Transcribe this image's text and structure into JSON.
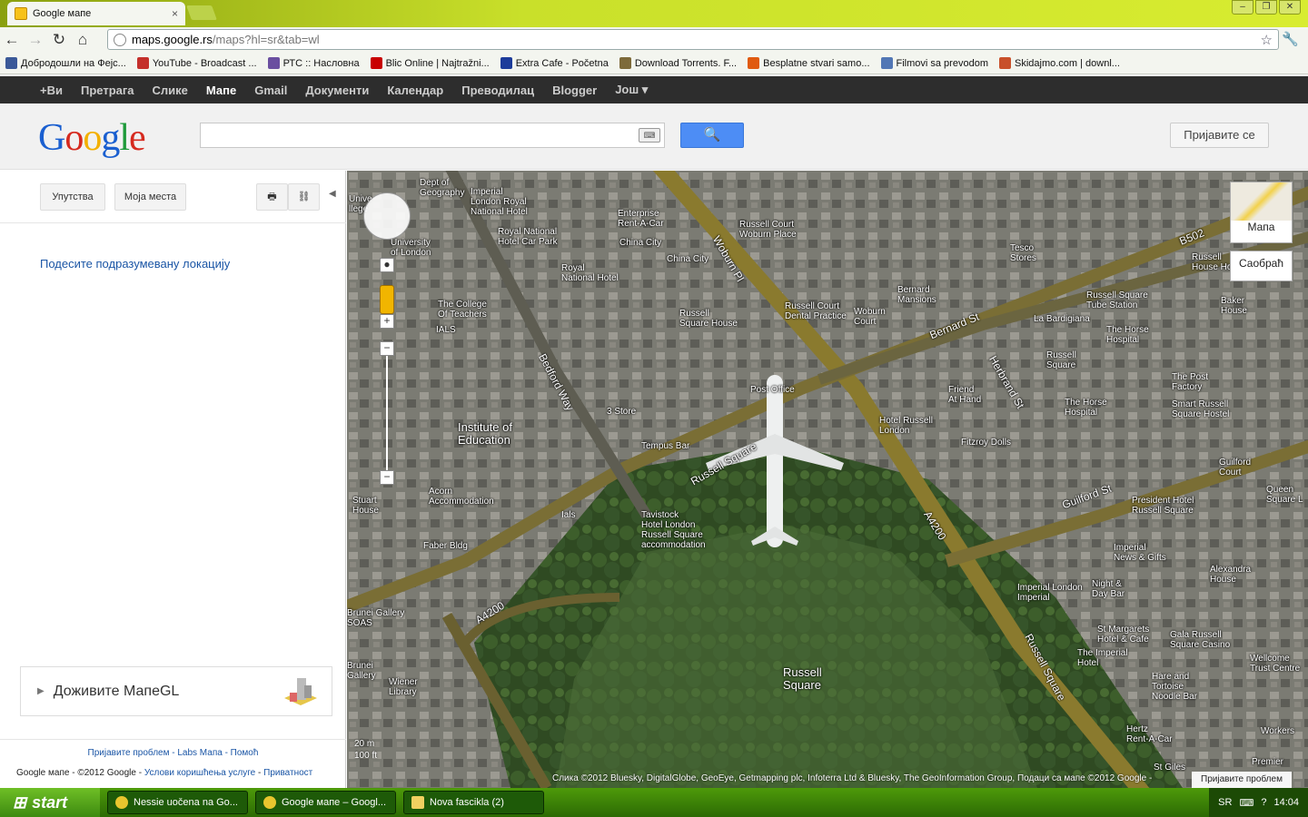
{
  "browser": {
    "tab_title": "Google мапе",
    "url_host": "maps.google.rs",
    "url_path": "/maps?hl=sr&tab=wl",
    "bookmarks": [
      "Добродошли на Фејс...",
      "YouTube - Broadcast ...",
      "РТС :: Насловна",
      "Blic Online | Najtražni...",
      "Extra Cafe - Početna",
      "Download Torrents. F...",
      "Besplatne stvari samo...",
      "Filmovi sa prevodom",
      "Skidajmo.com | downl..."
    ]
  },
  "gbar": {
    "items": [
      "+Ви",
      "Претрага",
      "Слике",
      "Мапе",
      "Gmail",
      "Документи",
      "Календар",
      "Преводилац",
      "Blogger",
      "Још ▾"
    ]
  },
  "header": {
    "sign_in": "Пријавите се"
  },
  "left_panel": {
    "directions": "Упутства",
    "my_places": "Моја места",
    "set_default": "Подесите подразумевану локацију",
    "mapsgl": "Доживите МапеGL",
    "footer_links": "Пријавите проблем - Labs Мапа - Помоћ",
    "footer_prefix": "Google мапе - ©2012 Google - ",
    "footer_terms": "Услови коришћења услуге",
    "footer_privacy": "Приватност"
  },
  "map": {
    "map_type": "Мапа",
    "traffic": "Саобраћ",
    "scale_m": "20 m",
    "scale_ft": "100 ft",
    "copyright": "Слика ©2012 Bluesky, DigitalGlobe, GeoEye, Getmapping plc, Infoterra Ltd & Bluesky, The GeoInformation Group, Подаци са мапе ©2012 Google -",
    "report": "Пријавите проблем",
    "labels": {
      "dept": "Dept of\nGeography",
      "imperial_london": "Imperial\nLondon Royal\nNational Hotel",
      "enterprise": "Enterprise\nRent-A-Car",
      "russell_court": "Russell Court\nWoburn Place",
      "univ": "University\nof London",
      "royal_national_car": "Royal National\nHotel Car Park",
      "china_city1": "China City",
      "china_city2": "China City",
      "royal_national": "Royal\nNational Hotel",
      "college_teachers": "The College\nOf Teachers",
      "ials": "IALS",
      "russell_square_house": "Russell\nSquare House",
      "russell_court_dental": "Russell Court\nDental Practice",
      "woburn_court": "Woburn\nCourt",
      "bernard_mansions": "Bernard\nMansions",
      "tesco": "Tesco\nStores",
      "russell_house_hotel": "Russell\nHouse Hotel",
      "baker_house": "Baker\nHouse",
      "rs_tube": "Russell Square\nTube Station",
      "la_bardigiana": "La Bardigiana",
      "horse_hospital": "The Horse\nHospital",
      "russell_sq_st": "Russell\nSquare",
      "post_office": "Post Office",
      "three_store": "3 Store",
      "institute": "Institute of\nEducation",
      "tempus": "Tempus Bar",
      "hotel_russell": "Hotel Russell\nLondon",
      "friend_hand": "Friend\nAt Hand",
      "fitzroy": "Fitzroy Dolls",
      "post_factory": "The Post\nFactory",
      "horse_hospital2": "The Horse\nHospital",
      "smart_russell": "Smart Russell\nSquare Hostel",
      "guilford_court": "Guilford\nCourt",
      "acorn": "Acorn\nAccommodation",
      "stuart_house": "Stuart\nHouse",
      "ials2": "Ials",
      "tavistock": "Tavistock\nHotel London\nRussell Square\naccommodation",
      "president": "President Hotel\nRussell Square",
      "faber": "Faber Bldg",
      "imperial_news": "Imperial\nNews & Gifts",
      "alexandra": "Alexandra\nHouse",
      "night_day": "Night &\nDay Bar",
      "imperial_london2": "Imperial London\nImperial",
      "brunei": "Brunei Gallery\nSOAS",
      "st_margarets": "St Margarets\nHotel & Cafe",
      "gala": "Gala Russell\nSquare Casino",
      "imperial_hotel": "The Imperial\nHotel",
      "hare": "Hare and\nTortoise\nNoodle Bar",
      "wellcome": "Wellcome\nTrust Centre",
      "brunei_gallery": "Brunei\nGallery",
      "wiener": "Wiener\nLibrary",
      "russell_square_park": "Russell\nSquare",
      "hertz": "Hertz\nRent-A-Car",
      "st_giles": "St Giles",
      "premier": "Premier",
      "workers": "Workers",
      "queen_sq": "Queen\nSquare L",
      "univ_college": "Unive\nllege"
    },
    "roads": {
      "woburn": "Woburn Pl",
      "bedford": "Bedford Way",
      "russell_sq_rd": "Russell Square",
      "bernard": "Bernard St",
      "herbrand": "Herbrand St",
      "a4200_1": "A4200",
      "a4200_2": "A4200",
      "guilford": "Guilford St",
      "russell_sq_rd2": "Russell Square",
      "b502": "B502"
    }
  },
  "taskbar": {
    "start": "start",
    "tasks": [
      "Nessie uočena na Go...",
      "Google мапе – Googl...",
      "Nova fascikla (2)"
    ],
    "lang": "SR",
    "clock": "14:04"
  },
  "colors": {
    "gbar_bg": "#2d2d2d",
    "search_btn": "#4d8df5",
    "link": "#1a55a5",
    "frame": "#c9e02a"
  }
}
